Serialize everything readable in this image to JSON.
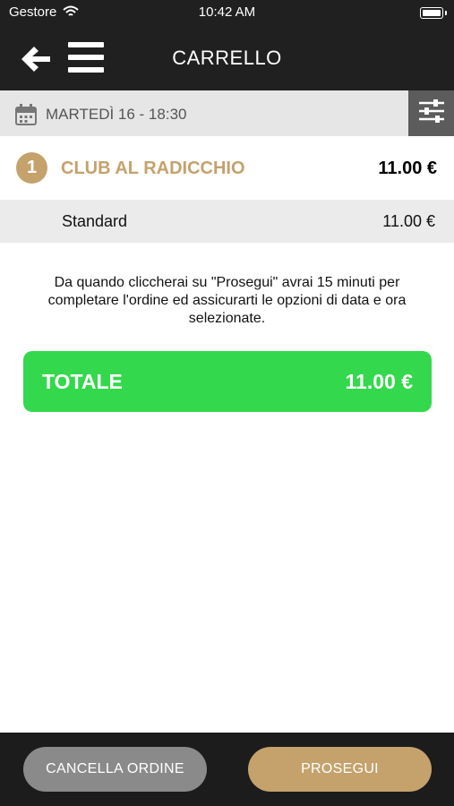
{
  "status_bar": {
    "carrier": "Gestore",
    "time": "10:42 AM"
  },
  "nav": {
    "title": "CARRELLO"
  },
  "date_bar": {
    "date_text": "MARTEDÌ 16 - 18:30"
  },
  "cart": {
    "items": [
      {
        "number": "1",
        "name": "CLUB AL RADICCHIO",
        "price": "11.00 €",
        "options": [
          {
            "label": "Standard",
            "price": "11.00 €"
          }
        ]
      }
    ]
  },
  "notice": "Da quando cliccherai su \"Prosegui\" avrai 15 minuti per completare l'ordine ed assicurarti le opzioni di data e ora selezionate.",
  "total": {
    "label": "TOTALE",
    "amount": "11.00 €"
  },
  "actions": {
    "cancel_label": "CANCELLA ORDINE",
    "next_label": "PROSEGUI"
  },
  "colors": {
    "gold": "#c5a16c",
    "green": "#34d84c",
    "dark": "#202020"
  },
  "icons": {
    "back": "arrow-left-icon",
    "menu": "hamburger-menu-icon",
    "calendar": "calendar-icon",
    "filter": "sliders-icon",
    "wifi": "wifi-icon",
    "battery": "battery-icon"
  }
}
